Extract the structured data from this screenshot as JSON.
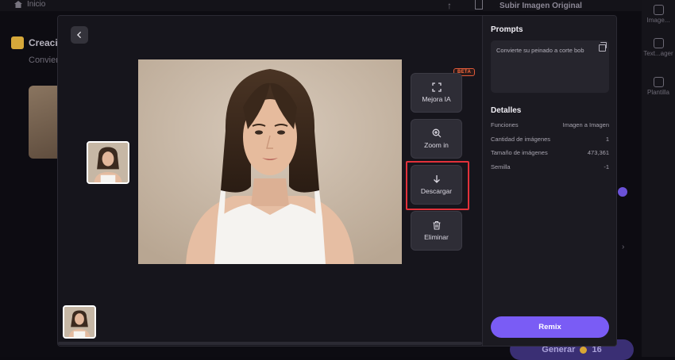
{
  "background": {
    "home_label": "Inicio",
    "upload_title": "Subir Imagen Original",
    "page_title": "Creació",
    "page_subtitle": "Convier",
    "generate_label": "Generar",
    "generate_cost": "16",
    "side_items": [
      "Image...",
      "Text...ager",
      "Plantilla"
    ]
  },
  "modal": {
    "actions": {
      "enhance": "Mejora IA",
      "beta": "BETA",
      "zoom": "Zoom in",
      "download": "Descargar",
      "delete": "Eliminar"
    },
    "panel": {
      "prompts_title": "Prompts",
      "prompt_text": "Convierte su peinado a corte bob",
      "details_title": "Detalles",
      "details": [
        {
          "label": "Funciones",
          "value": "Imagen a Imagen"
        },
        {
          "label": "Cantidad de imágenes",
          "value": "1"
        },
        {
          "label": "Tamaño de imágenes",
          "value": "473,361"
        },
        {
          "label": "Semilla",
          "value": "-1"
        }
      ],
      "remix_label": "Remix"
    }
  },
  "colors": {
    "accent": "#7a5cf5",
    "highlight": "#e2313a",
    "beta": "#ff6b3d"
  }
}
